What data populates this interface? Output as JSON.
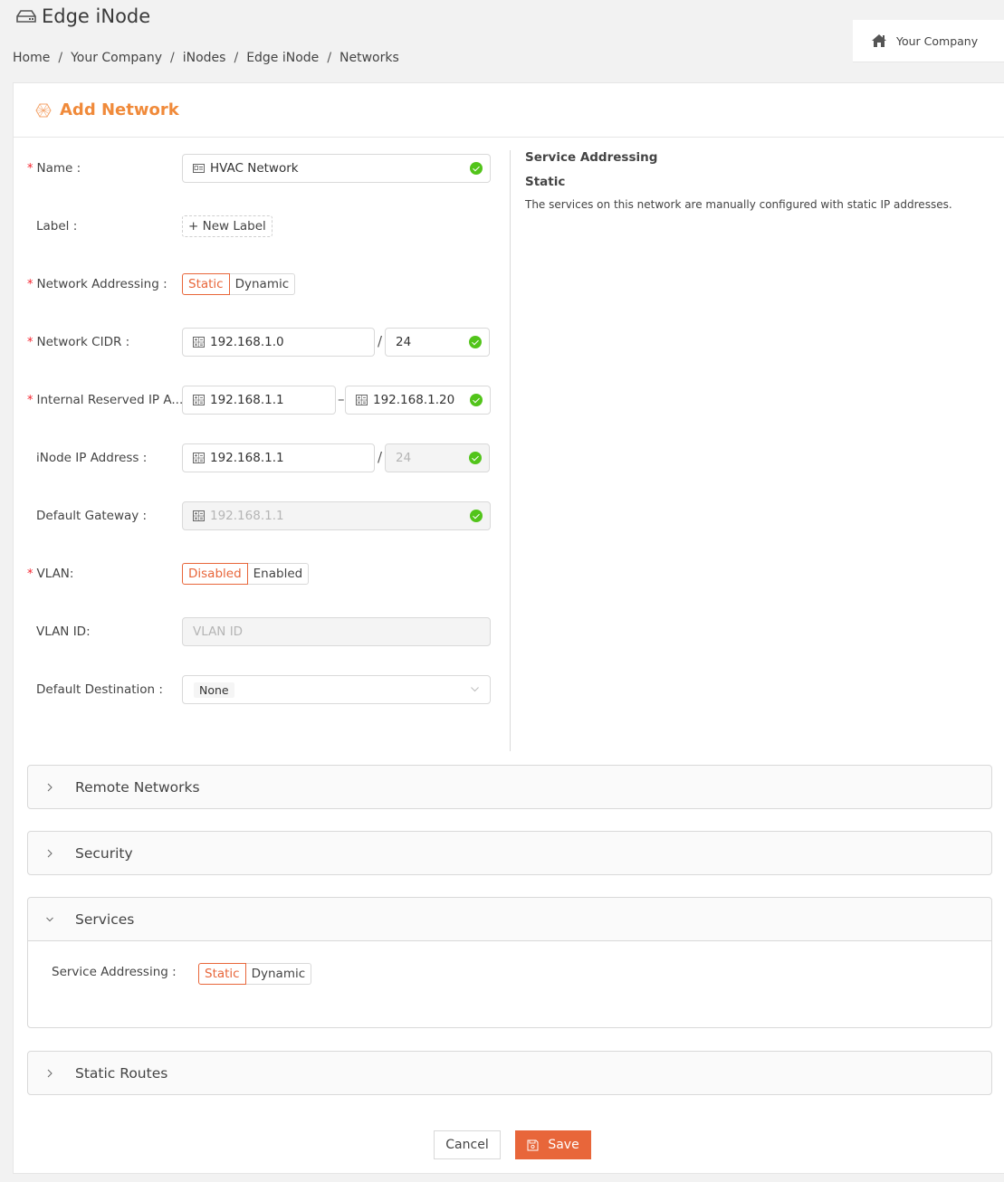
{
  "header": {
    "title": "Edge iNode",
    "title_icon": "inode-device-icon",
    "breadcrumb": [
      "Home",
      "Your Company",
      "iNodes",
      "Edge iNode",
      "Networks"
    ],
    "breadcrumb_separator": "/",
    "company": "Your Company",
    "company_icon": "home-icon"
  },
  "card": {
    "title": "Add Network",
    "title_icon": "network-icon",
    "accent_color": "#f08a3a"
  },
  "form": {
    "name": {
      "label": "Name :",
      "required": true,
      "value": "HVAC Network",
      "valid": true
    },
    "label": {
      "label": "Label :",
      "button": "+ New Label"
    },
    "network_addressing": {
      "label": "Network Addressing :",
      "required": true,
      "options": [
        "Static",
        "Dynamic"
      ],
      "selected": "Static"
    },
    "network_cidr": {
      "label": "Network CIDR :",
      "required": true,
      "ip": "192.168.1.0",
      "separator": "/",
      "prefix": "24",
      "valid": true
    },
    "reserved_ip": {
      "label": "Internal Reserved IP A...",
      "required": true,
      "start": "192.168.1.1",
      "separator": "–",
      "end": "192.168.1.20",
      "valid": true
    },
    "inode_ip": {
      "label": "iNode IP Address :",
      "ip": "192.168.1.1",
      "separator": "/",
      "prefix": "24",
      "valid": true
    },
    "default_gateway": {
      "label": "Default Gateway :",
      "value": "192.168.1.1",
      "disabled": true,
      "valid": true
    },
    "vlan": {
      "label": "VLAN:",
      "required": true,
      "options": [
        "Disabled",
        "Enabled"
      ],
      "selected": "Disabled"
    },
    "vlan_id": {
      "label": "VLAN ID:",
      "placeholder": "VLAN ID",
      "disabled": true
    },
    "default_destination": {
      "label": "Default Destination :",
      "value": "None"
    },
    "required_marker": "*"
  },
  "help": {
    "heading": "Service Addressing",
    "subheading": "Static",
    "text": "The services on this network are manually configured with static IP addresses."
  },
  "panels": [
    {
      "title": "Remote Networks",
      "expanded": false
    },
    {
      "title": "Security",
      "expanded": false
    },
    {
      "title": "Services",
      "expanded": true,
      "content": {
        "label": "Service Addressing :",
        "options": [
          "Static",
          "Dynamic"
        ],
        "selected": "Static"
      }
    },
    {
      "title": "Static Routes",
      "expanded": false
    }
  ],
  "footer": {
    "cancel": "Cancel",
    "save": "Save",
    "save_color": "#e8663a"
  }
}
